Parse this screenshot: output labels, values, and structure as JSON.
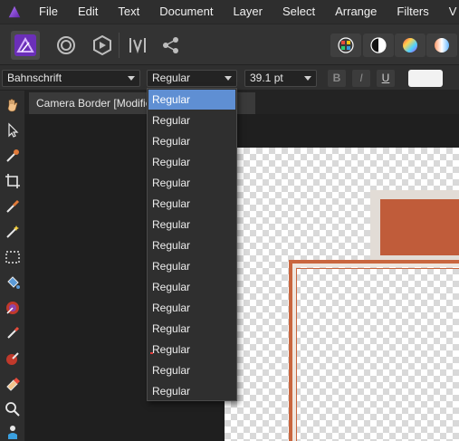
{
  "menu": {
    "items": [
      "File",
      "Edit",
      "Text",
      "Document",
      "Layer",
      "Select",
      "Arrange",
      "Filters",
      "V"
    ]
  },
  "toolbar": {
    "personas": [
      "publisher-persona-icon",
      "designer-persona-icon",
      "photo-persona-icon",
      "export-persona-icon",
      "share-icon"
    ],
    "right_buttons": [
      "color-wheel-icon",
      "contrast-icon",
      "hue-circle-icon",
      "gradient-circle-icon"
    ]
  },
  "context_bar": {
    "font_family": "Bahnschrift",
    "font_style": "Regular",
    "font_size": "39.1 pt",
    "bold_label": "B",
    "italic_label": "I",
    "underline_label": "U",
    "text_color": "#f2f2f2"
  },
  "document": {
    "tab_title": "Camera Border [Modified]"
  },
  "dropdown": {
    "options": [
      "Regular",
      "Regular",
      "Regular",
      "Regular",
      "Regular",
      "Regular",
      "Regular",
      "Regular",
      "Regular",
      "Regular",
      "Regular",
      "Regular",
      "Regular",
      "Regular",
      "Regular"
    ],
    "selected_index": 0
  },
  "colors": {
    "accent_selection": "#5f8fd3",
    "frame_orange": "#c05c3a",
    "frame_outline": "#c9663f"
  }
}
